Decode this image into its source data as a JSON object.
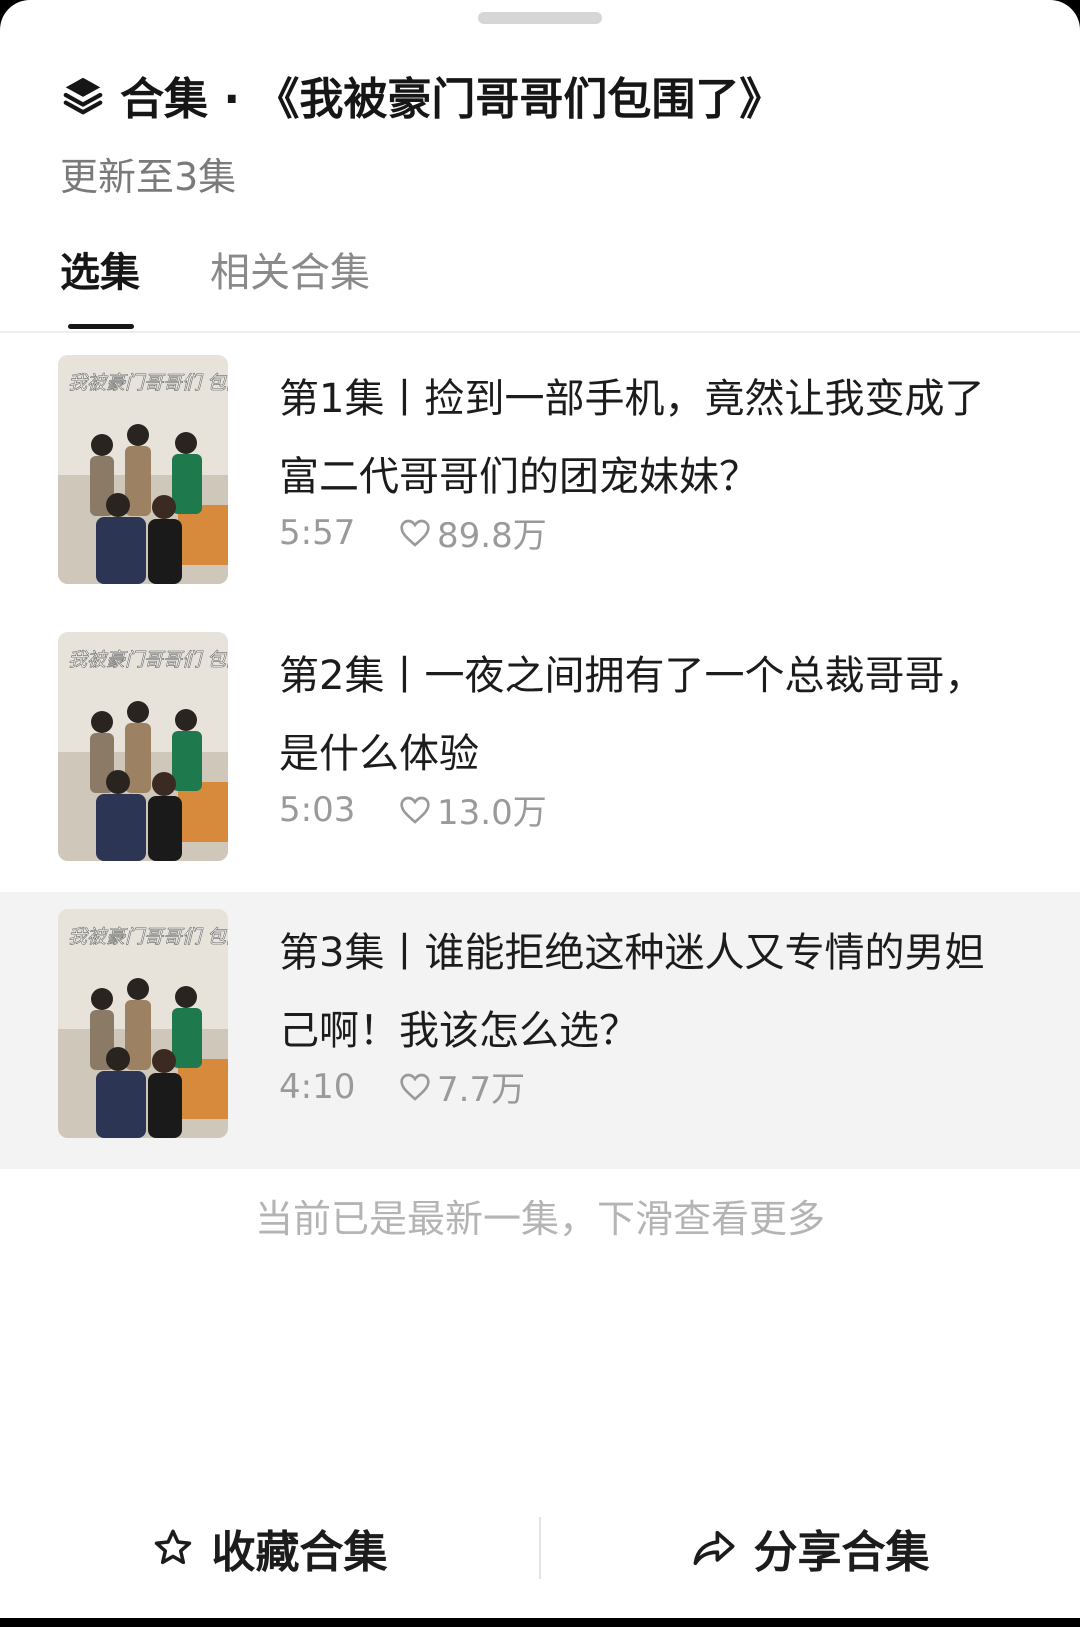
{
  "header": {
    "title": "合集 · 《我被豪门哥哥们包围了》",
    "subtitle": "更新至3集"
  },
  "tabs": [
    {
      "label": "选集",
      "active": true
    },
    {
      "label": "相关合集",
      "active": false
    }
  ],
  "episodes": [
    {
      "title": "第1集丨捡到一部手机，竟然让我变成了富二代哥哥们的团宠妹妹？",
      "duration": "5:57",
      "likes": "89.8万",
      "poster_text": "我被豪门哥哥们 包围了",
      "current": false
    },
    {
      "title": "第2集丨一夜之间拥有了一个总裁哥哥，是什么体验",
      "duration": "5:03",
      "likes": "13.0万",
      "poster_text": "我被豪门哥哥们 包围了",
      "current": false
    },
    {
      "title": "第3集丨谁能拒绝这种迷人又专情的男妲己啊！我该怎么选？",
      "duration": "4:10",
      "likes": "7.7万",
      "poster_text": "我被豪门哥哥们 包围了",
      "current": true
    }
  ],
  "footer_note": "当前已是最新一集，下滑查看更多",
  "bottom_bar": {
    "collect_label": "收藏合集",
    "share_label": "分享合集"
  },
  "icons": {
    "title": "stack-layers-icon",
    "like": "heart-outline-icon",
    "collect": "star-outline-icon",
    "share": "share-arrow-icon"
  },
  "colors": {
    "current_row_bg": "#f3f3f3",
    "primary_text": "#161616",
    "secondary_text": "#9a9a9a"
  }
}
